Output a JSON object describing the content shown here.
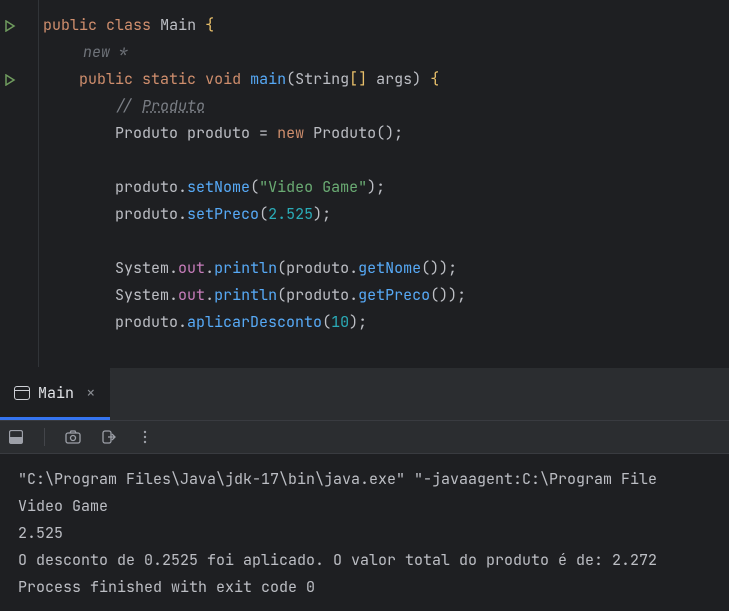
{
  "code": {
    "line1": {
      "kw1": "public",
      "kw2": "class",
      "cls": "Main",
      "brace": "{"
    },
    "line2": {
      "hint": "new *"
    },
    "line3": {
      "kw1": "public",
      "kw2": "static",
      "kw3": "void",
      "meth": "main",
      "p1": "(",
      "type": "String",
      "arr": "[]",
      "arg": " args",
      "p2": ")",
      "brace": " {"
    },
    "line4": {
      "com1": "// ",
      "com2": "Produto"
    },
    "line5": {
      "type": "Produto",
      "var": " produto ",
      "eq": "=",
      "kw": " new ",
      "ctor": "Produto",
      "call": "();"
    },
    "line6": {
      "var": "produto",
      "dot": ".",
      "meth": "setNome",
      "p1": "(",
      "str": "\"Video Game\"",
      "p2": ");"
    },
    "line7": {
      "var": "produto",
      "dot": ".",
      "meth": "setPreco",
      "p1": "(",
      "num": "2.525",
      "p2": ");"
    },
    "line8": {
      "cls": "System",
      "dot1": ".",
      "field": "out",
      "dot2": ".",
      "meth": "println",
      "p1": "(",
      "arg": "produto",
      "dot3": ".",
      "call": "getNome",
      "p2": "());"
    },
    "line9": {
      "cls": "System",
      "dot1": ".",
      "field": "out",
      "dot2": ".",
      "meth": "println",
      "p1": "(",
      "arg": "produto",
      "dot3": ".",
      "call": "getPreco",
      "p2": "());"
    },
    "line10": {
      "var": "produto",
      "dot": ".",
      "meth": "aplicarDesconto",
      "p1": "(",
      "num": "10",
      "p2": ");"
    }
  },
  "tab": {
    "name": "Main"
  },
  "console": {
    "l1": "\"C:\\Program Files\\Java\\jdk-17\\bin\\java.exe\" \"-javaagent:C:\\Program File",
    "l2": "Video Game",
    "l3": "2.525",
    "l4": "O desconto de 0.2525 foi aplicado. O valor total do produto é de: 2.272",
    "l5": "Process finished with exit code 0"
  }
}
